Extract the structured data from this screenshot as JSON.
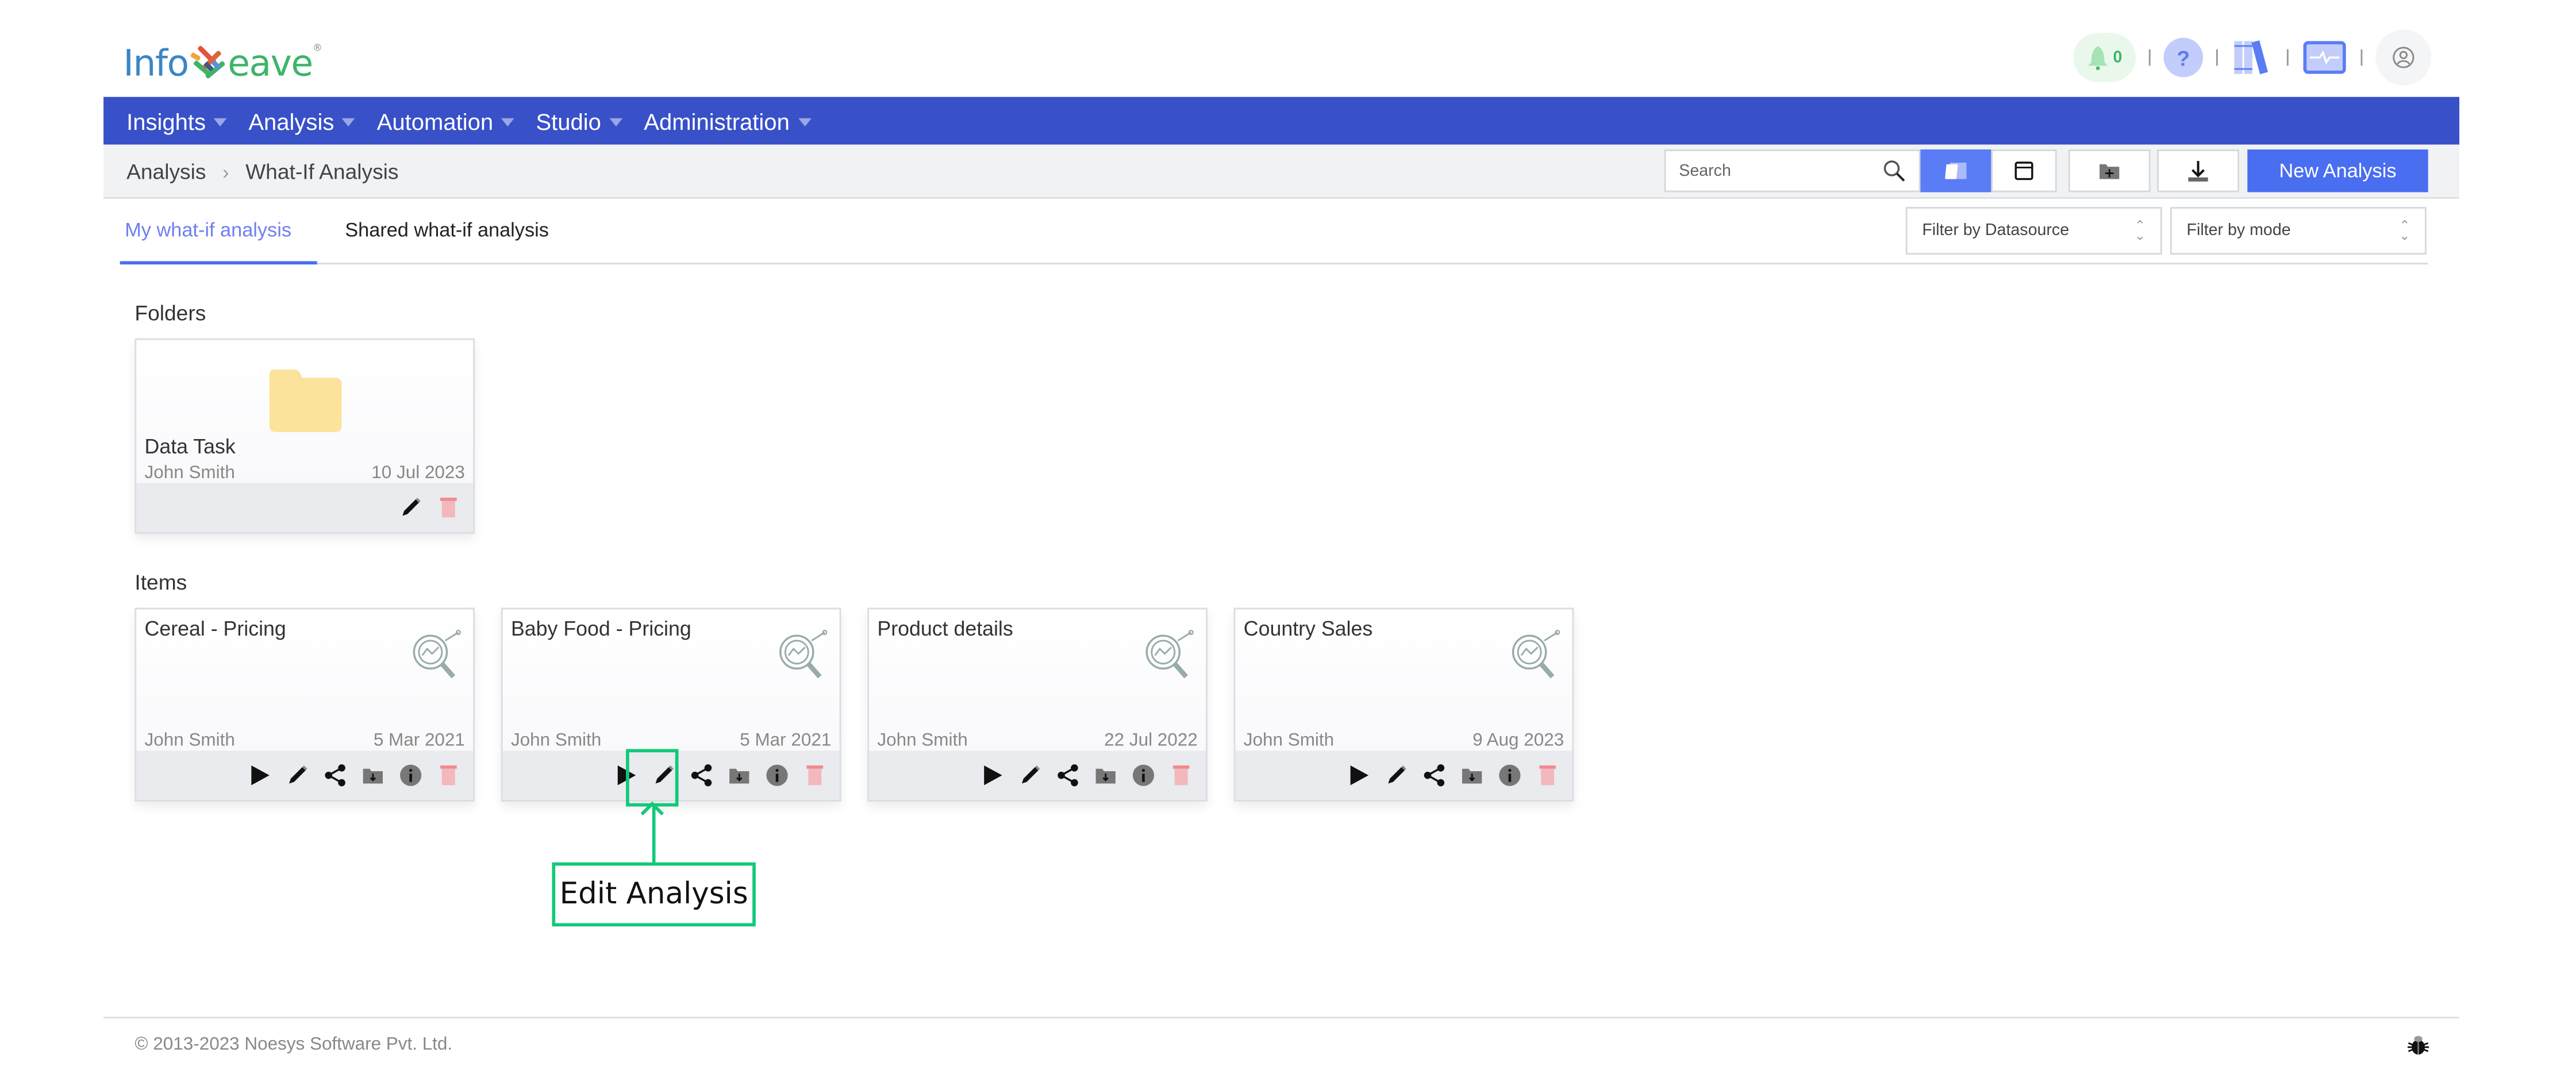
{
  "header": {
    "logo_left": "Info",
    "logo_right": "eave",
    "logo_registered": "®",
    "notification_count": "0",
    "icons": [
      "bell-icon",
      "help-icon",
      "library-icon",
      "monitor-icon",
      "user-icon"
    ]
  },
  "nav": {
    "items": [
      {
        "label": "Insights"
      },
      {
        "label": "Analysis"
      },
      {
        "label": "Automation"
      },
      {
        "label": "Studio"
      },
      {
        "label": "Administration"
      }
    ]
  },
  "breadcrumb": {
    "items": [
      "Analysis",
      "What-If Analysis"
    ],
    "separator": "›"
  },
  "toolbar": {
    "search_placeholder": "Search",
    "new_button_label": "New Analysis",
    "buttons": [
      "card-view-icon",
      "list-view-icon",
      "new-folder-icon",
      "import-icon"
    ]
  },
  "tabs": [
    {
      "label": "My what-if analysis",
      "active": true
    },
    {
      "label": "Shared what-if analysis",
      "active": false
    }
  ],
  "filters": {
    "datasource_placeholder": "Filter by Datasource",
    "mode_placeholder": "Filter by mode"
  },
  "folders": {
    "title": "Folders",
    "items": [
      {
        "name": "Data Task",
        "owner": "John Smith",
        "date": "10 Jul 2023"
      }
    ]
  },
  "items": {
    "title": "Items",
    "list": [
      {
        "name": "Cereal - Pricing",
        "owner": "John Smith",
        "date": "5 Mar 2021"
      },
      {
        "name": "Baby Food - Pricing",
        "owner": "John Smith",
        "date": "5 Mar 2021"
      },
      {
        "name": "Product details",
        "owner": "John Smith",
        "date": "22 Jul 2022"
      },
      {
        "name": "Country Sales",
        "owner": "John Smith",
        "date": "9 Aug 2023"
      }
    ]
  },
  "annotation": {
    "label": "Edit Analysis",
    "color": "#12c97a"
  },
  "footer": {
    "copyright": "© 2013-2023 Noesys Software Pvt. Ltd."
  },
  "colors": {
    "nav_bg": "#3850c8",
    "accent": "#4a6ef0",
    "folder": "#fbe39c",
    "delete": "#f2aeb4"
  }
}
